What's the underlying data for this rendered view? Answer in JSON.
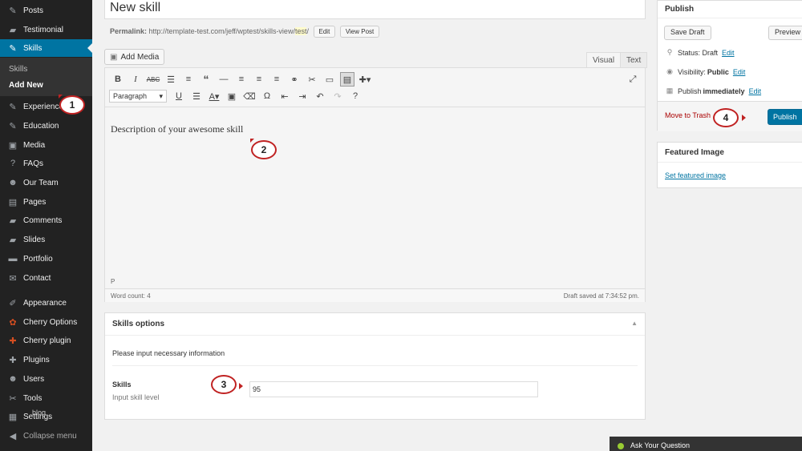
{
  "sidebar": {
    "items": [
      {
        "label": "Posts",
        "icon": "pin-icon",
        "glyph": "✎"
      },
      {
        "label": "Testimonial",
        "icon": "speech-bubble-icon",
        "glyph": "▰"
      },
      {
        "label": "Skills",
        "icon": "pin-icon",
        "glyph": "✎"
      },
      {
        "label": "Experience",
        "icon": "pin-icon",
        "glyph": "✎"
      },
      {
        "label": "Education",
        "icon": "pin-icon",
        "glyph": "✎"
      },
      {
        "label": "Media",
        "icon": "media-icon",
        "glyph": "▣"
      },
      {
        "label": "FAQs",
        "icon": "question-icon",
        "glyph": "?"
      },
      {
        "label": "Our Team",
        "icon": "person-icon",
        "glyph": "☻"
      },
      {
        "label": "Pages",
        "icon": "pages-icon",
        "glyph": "▤"
      },
      {
        "label": "Comments",
        "icon": "comment-icon",
        "glyph": "▰"
      },
      {
        "label": "Slides",
        "icon": "slides-icon",
        "glyph": "▰"
      },
      {
        "label": "Portfolio",
        "icon": "folder-icon",
        "glyph": "▬"
      },
      {
        "label": "Contact",
        "icon": "mail-icon",
        "glyph": "✉"
      },
      {
        "label": "Appearance",
        "icon": "brush-icon",
        "glyph": "✐"
      },
      {
        "label": "Cherry Options",
        "icon": "cherry-icon",
        "glyph": "✿"
      },
      {
        "label": "Cherry plugin",
        "icon": "plugin-icon",
        "glyph": "✚"
      },
      {
        "label": "Plugins",
        "icon": "plugin-icon",
        "glyph": "✚"
      },
      {
        "label": "Users",
        "icon": "users-icon",
        "glyph": "☻"
      },
      {
        "label": "Tools",
        "icon": "wrench-icon",
        "glyph": "✂"
      },
      {
        "label": "Settings",
        "icon": "settings-icon",
        "glyph": "▦"
      },
      {
        "label": "Collapse menu",
        "icon": "collapse-icon",
        "glyph": "◀"
      }
    ],
    "submenu": {
      "skills": "Skills",
      "add_new": "Add New"
    },
    "overlap_label": "blog"
  },
  "editor": {
    "title": "New skill",
    "permalink_label": "Permalink:",
    "permalink_base": "http://template-test.com/jeff/wptest/skills-view/",
    "permalink_slug": "test",
    "permalink_tail": "/",
    "edit_btn": "Edit",
    "view_post_btn": "View Post",
    "add_media": "Add Media",
    "tab_visual": "Visual",
    "tab_text": "Text",
    "format_select": "Paragraph",
    "content": "Description of your awesome skill",
    "path": "P",
    "word_count": "Word count: 4",
    "draft_saved": "Draft saved at 7:34:52 pm."
  },
  "skills_options": {
    "title": "Skills options",
    "info": "Please input necessary information",
    "field_label": "Skills",
    "field_desc": "Input skill level",
    "field_value": "95"
  },
  "publish": {
    "title": "Publish",
    "save_draft": "Save Draft",
    "preview": "Preview",
    "status_label": "Status: Draft",
    "status_edit": "Edit",
    "visibility_label": "Visibility:",
    "visibility_value": "Public",
    "visibility_edit": "Edit",
    "schedule_label": "Publish",
    "schedule_value": "immediately",
    "schedule_edit": "Edit",
    "trash": "Move to Trash",
    "publish_btn": "Publish"
  },
  "featured": {
    "title": "Featured Image",
    "link": "Set featured image"
  },
  "callouts": [
    "1",
    "2",
    "3",
    "4"
  ],
  "popup": {
    "text": "Ask Your Question"
  },
  "colors": {
    "accent": "#0074a2",
    "sidebar": "#222222",
    "callout": "#c02222"
  }
}
